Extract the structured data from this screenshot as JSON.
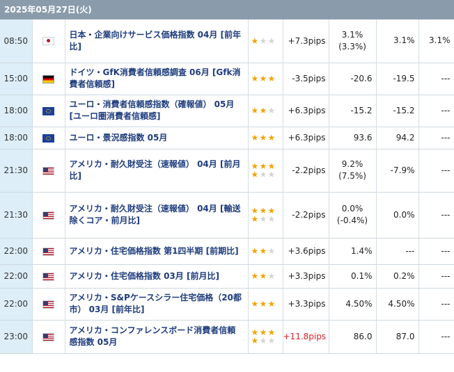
{
  "date_header": "2025年05月27日(火)",
  "star_glyph": "★",
  "rows": [
    {
      "time": "08:50",
      "flag": "jp",
      "country_icon": "japan-flag-icon",
      "name": "日本・企業向けサービス価格指数 04月 [前年比]",
      "stars": 1,
      "pips": "+7.3pips",
      "pips_color": "",
      "result": "3.1%(3.3%)",
      "forecast": "3.1%",
      "previous": "3.1%"
    },
    {
      "time": "15:00",
      "flag": "de",
      "country_icon": "germany-flag-icon",
      "name": "ドイツ・GfK消費者信頼感調査 06月 [Gfk消費者信頼感]",
      "stars": 3,
      "pips": "-3.5pips",
      "pips_color": "",
      "result": "-20.6",
      "forecast": "-19.5",
      "previous": "---"
    },
    {
      "time": "18:00",
      "flag": "eu",
      "country_icon": "eu-flag-icon",
      "name": "ユーロ・消費者信頼感指数（確報値） 05月 [ユーロ圏消費者信頼感]",
      "stars": 2,
      "pips": "+6.3pips",
      "pips_color": "",
      "result": "-15.2",
      "forecast": "-15.2",
      "previous": "---"
    },
    {
      "time": "18:00",
      "flag": "eu",
      "country_icon": "eu-flag-icon",
      "name": "ユーロ・景況感指数 05月",
      "stars": 3,
      "pips": "+6.3pips",
      "pips_color": "",
      "result": "93.6",
      "forecast": "94.2",
      "previous": "---"
    },
    {
      "time": "21:30",
      "flag": "us",
      "country_icon": "usa-flag-icon",
      "name": "アメリカ・耐久財受注（速報値） 04月 [前月比]",
      "stars": 4,
      "pips": "-2.2pips",
      "pips_color": "",
      "result": "9.2%(7.5%)",
      "forecast": "-7.9%",
      "previous": "---"
    },
    {
      "time": "21:30",
      "flag": "us",
      "country_icon": "usa-flag-icon",
      "name": "アメリカ・耐久財受注（速報値） 04月 [輸送除くコア・前月比]",
      "stars": 4,
      "pips": "-2.2pips",
      "pips_color": "",
      "result": "0.0%(-0.4%)",
      "forecast": "0.0%",
      "previous": "---"
    },
    {
      "time": "22:00",
      "flag": "us",
      "country_icon": "usa-flag-icon",
      "name": "アメリカ・住宅価格指数 第1四半期 [前期比]",
      "stars": 2,
      "pips": "+3.6pips",
      "pips_color": "",
      "result": "1.4%",
      "forecast": "---",
      "previous": "---"
    },
    {
      "time": "22:00",
      "flag": "us",
      "country_icon": "usa-flag-icon",
      "name": "アメリカ・住宅価格指数 03月 [前月比]",
      "stars": 2,
      "pips": "+3.3pips",
      "pips_color": "",
      "result": "0.1%",
      "forecast": "0.2%",
      "previous": "---"
    },
    {
      "time": "22:00",
      "flag": "us",
      "country_icon": "usa-flag-icon",
      "name": "アメリカ・S&Pケースシラー住宅価格（20都市） 03月 [前年比]",
      "stars": 3,
      "pips": "+3.3pips",
      "pips_color": "",
      "result": "4.50%",
      "forecast": "4.50%",
      "previous": "---"
    },
    {
      "time": "23:00",
      "flag": "us",
      "country_icon": "usa-flag-icon",
      "name": "アメリカ・コンファレンスボード消費者信頼感指数 05月",
      "stars": 4,
      "pips": "+11.8pips",
      "pips_color": "#d8202a",
      "result": "86.0",
      "forecast": "87.0",
      "previous": "---"
    }
  ]
}
